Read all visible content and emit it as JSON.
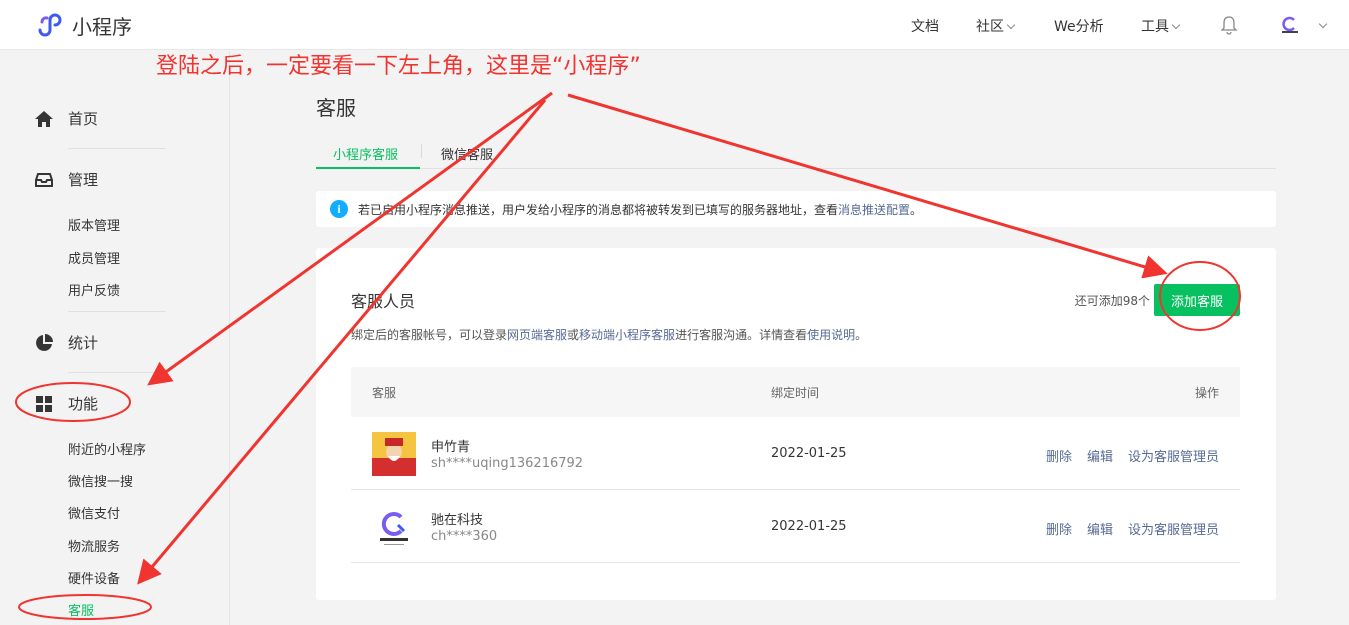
{
  "header": {
    "app_name": "小程序",
    "nav": [
      "文档",
      "社区",
      "We分析",
      "工具"
    ]
  },
  "sidebar": {
    "home": "首页",
    "manage": "管理",
    "manage_items": [
      "版本管理",
      "成员管理",
      "用户反馈"
    ],
    "stats": "统计",
    "features": "功能",
    "feature_items": [
      "附近的小程序",
      "微信搜一搜",
      "微信支付",
      "物流服务",
      "硬件设备",
      "客服"
    ]
  },
  "main": {
    "title": "客服",
    "tabs": [
      "小程序客服",
      "微信客服"
    ],
    "notice": {
      "text": "若已启用小程序消息推送，用户发给小程序的消息都将被转发到已填写的服务器地址，查看 ",
      "link": "消息推送配置",
      "end": "。"
    },
    "card": {
      "title": "客服人员",
      "desc_1": "绑定后的客服帐号，可以登录",
      "link_web": "网页端客服",
      "desc_2": "或",
      "link_mobile": "移动端小程序客服",
      "desc_3": "进行客服沟通。详情查看",
      "link_usage": "使用说明",
      "desc_4": "。",
      "remaining": "还可添加98个",
      "add_button": "添加客服"
    },
    "table": {
      "headers": [
        "客服",
        "绑定时间",
        "操作"
      ],
      "rows": [
        {
          "name": "申竹青",
          "account": "sh****uqing136216792",
          "date": "2022-01-25",
          "ops": [
            "删除",
            "编辑",
            "设为客服管理员"
          ]
        },
        {
          "name": "驰在科技",
          "account": "ch****360",
          "date": "2022-01-25",
          "ops": [
            "删除",
            "编辑",
            "设为客服管理员"
          ]
        }
      ]
    }
  },
  "annotation": {
    "text": "登陆之后，一定要看一下左上角，这里是“小程序”"
  },
  "colors": {
    "accent": "#07c160",
    "link": "#576b95",
    "annotation": "#f0342f"
  }
}
